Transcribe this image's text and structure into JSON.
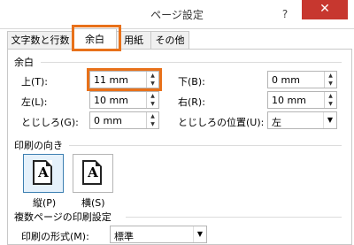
{
  "window": {
    "title": "ページ設定",
    "help_label": "?",
    "close_label": "✕"
  },
  "tabs": [
    {
      "label": "文字数と行数",
      "active": false
    },
    {
      "label": "余白",
      "active": true
    },
    {
      "label": "用紙",
      "active": false
    },
    {
      "label": "その他",
      "active": false
    }
  ],
  "margins": {
    "group_title": "余白",
    "top": {
      "label": "上(T):",
      "value": "11 mm"
    },
    "bottom": {
      "label": "下(B):",
      "value": "0 mm"
    },
    "left": {
      "label": "左(L):",
      "value": "10 mm"
    },
    "right": {
      "label": "右(R):",
      "value": "10 mm"
    },
    "gutter": {
      "label": "とじしろ(G):",
      "value": "0 mm"
    },
    "gutter_position": {
      "label": "とじしろの位置(U):",
      "value": "左"
    }
  },
  "orientation": {
    "group_title": "印刷の向き",
    "portrait": {
      "label": "縦(P)",
      "glyph": "A",
      "selected": true
    },
    "landscape": {
      "label": "横(S)",
      "glyph": "A",
      "selected": false
    }
  },
  "multiple_pages": {
    "group_title": "複数ページの印刷設定",
    "format_label": "印刷の形式(M):",
    "format_value": "標準"
  },
  "colors": {
    "highlight": "#e8711a",
    "close_button": "#c7372f",
    "selected_border": "#3c7fb1"
  }
}
